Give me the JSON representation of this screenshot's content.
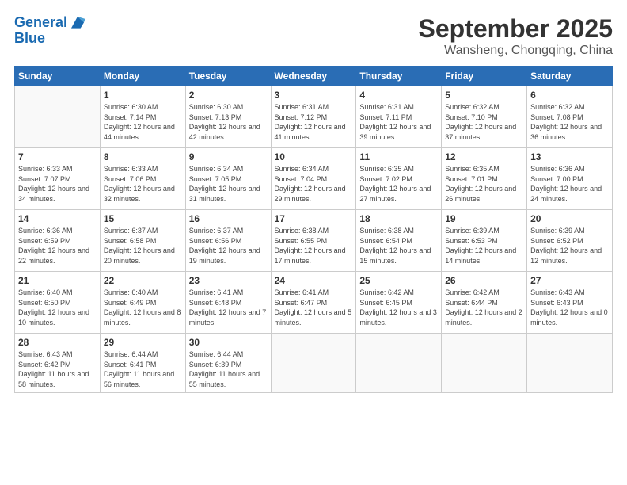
{
  "header": {
    "logo_line1": "General",
    "logo_line2": "Blue",
    "title": "September 2025",
    "subtitle": "Wansheng, Chongqing, China"
  },
  "weekdays": [
    "Sunday",
    "Monday",
    "Tuesday",
    "Wednesday",
    "Thursday",
    "Friday",
    "Saturday"
  ],
  "weeks": [
    [
      {
        "day": "",
        "empty": true
      },
      {
        "day": "1",
        "sunrise": "6:30 AM",
        "sunset": "7:14 PM",
        "daylight": "12 hours and 44 minutes."
      },
      {
        "day": "2",
        "sunrise": "6:30 AM",
        "sunset": "7:13 PM",
        "daylight": "12 hours and 42 minutes."
      },
      {
        "day": "3",
        "sunrise": "6:31 AM",
        "sunset": "7:12 PM",
        "daylight": "12 hours and 41 minutes."
      },
      {
        "day": "4",
        "sunrise": "6:31 AM",
        "sunset": "7:11 PM",
        "daylight": "12 hours and 39 minutes."
      },
      {
        "day": "5",
        "sunrise": "6:32 AM",
        "sunset": "7:10 PM",
        "daylight": "12 hours and 37 minutes."
      },
      {
        "day": "6",
        "sunrise": "6:32 AM",
        "sunset": "7:08 PM",
        "daylight": "12 hours and 36 minutes."
      }
    ],
    [
      {
        "day": "7",
        "sunrise": "6:33 AM",
        "sunset": "7:07 PM",
        "daylight": "12 hours and 34 minutes."
      },
      {
        "day": "8",
        "sunrise": "6:33 AM",
        "sunset": "7:06 PM",
        "daylight": "12 hours and 32 minutes."
      },
      {
        "day": "9",
        "sunrise": "6:34 AM",
        "sunset": "7:05 PM",
        "daylight": "12 hours and 31 minutes."
      },
      {
        "day": "10",
        "sunrise": "6:34 AM",
        "sunset": "7:04 PM",
        "daylight": "12 hours and 29 minutes."
      },
      {
        "day": "11",
        "sunrise": "6:35 AM",
        "sunset": "7:02 PM",
        "daylight": "12 hours and 27 minutes."
      },
      {
        "day": "12",
        "sunrise": "6:35 AM",
        "sunset": "7:01 PM",
        "daylight": "12 hours and 26 minutes."
      },
      {
        "day": "13",
        "sunrise": "6:36 AM",
        "sunset": "7:00 PM",
        "daylight": "12 hours and 24 minutes."
      }
    ],
    [
      {
        "day": "14",
        "sunrise": "6:36 AM",
        "sunset": "6:59 PM",
        "daylight": "12 hours and 22 minutes."
      },
      {
        "day": "15",
        "sunrise": "6:37 AM",
        "sunset": "6:58 PM",
        "daylight": "12 hours and 20 minutes."
      },
      {
        "day": "16",
        "sunrise": "6:37 AM",
        "sunset": "6:56 PM",
        "daylight": "12 hours and 19 minutes."
      },
      {
        "day": "17",
        "sunrise": "6:38 AM",
        "sunset": "6:55 PM",
        "daylight": "12 hours and 17 minutes."
      },
      {
        "day": "18",
        "sunrise": "6:38 AM",
        "sunset": "6:54 PM",
        "daylight": "12 hours and 15 minutes."
      },
      {
        "day": "19",
        "sunrise": "6:39 AM",
        "sunset": "6:53 PM",
        "daylight": "12 hours and 14 minutes."
      },
      {
        "day": "20",
        "sunrise": "6:39 AM",
        "sunset": "6:52 PM",
        "daylight": "12 hours and 12 minutes."
      }
    ],
    [
      {
        "day": "21",
        "sunrise": "6:40 AM",
        "sunset": "6:50 PM",
        "daylight": "12 hours and 10 minutes."
      },
      {
        "day": "22",
        "sunrise": "6:40 AM",
        "sunset": "6:49 PM",
        "daylight": "12 hours and 8 minutes."
      },
      {
        "day": "23",
        "sunrise": "6:41 AM",
        "sunset": "6:48 PM",
        "daylight": "12 hours and 7 minutes."
      },
      {
        "day": "24",
        "sunrise": "6:41 AM",
        "sunset": "6:47 PM",
        "daylight": "12 hours and 5 minutes."
      },
      {
        "day": "25",
        "sunrise": "6:42 AM",
        "sunset": "6:45 PM",
        "daylight": "12 hours and 3 minutes."
      },
      {
        "day": "26",
        "sunrise": "6:42 AM",
        "sunset": "6:44 PM",
        "daylight": "12 hours and 2 minutes."
      },
      {
        "day": "27",
        "sunrise": "6:43 AM",
        "sunset": "6:43 PM",
        "daylight": "12 hours and 0 minutes."
      }
    ],
    [
      {
        "day": "28",
        "sunrise": "6:43 AM",
        "sunset": "6:42 PM",
        "daylight": "11 hours and 58 minutes."
      },
      {
        "day": "29",
        "sunrise": "6:44 AM",
        "sunset": "6:41 PM",
        "daylight": "11 hours and 56 minutes."
      },
      {
        "day": "30",
        "sunrise": "6:44 AM",
        "sunset": "6:39 PM",
        "daylight": "11 hours and 55 minutes."
      },
      {
        "day": "",
        "empty": true
      },
      {
        "day": "",
        "empty": true
      },
      {
        "day": "",
        "empty": true
      },
      {
        "day": "",
        "empty": true
      }
    ]
  ]
}
